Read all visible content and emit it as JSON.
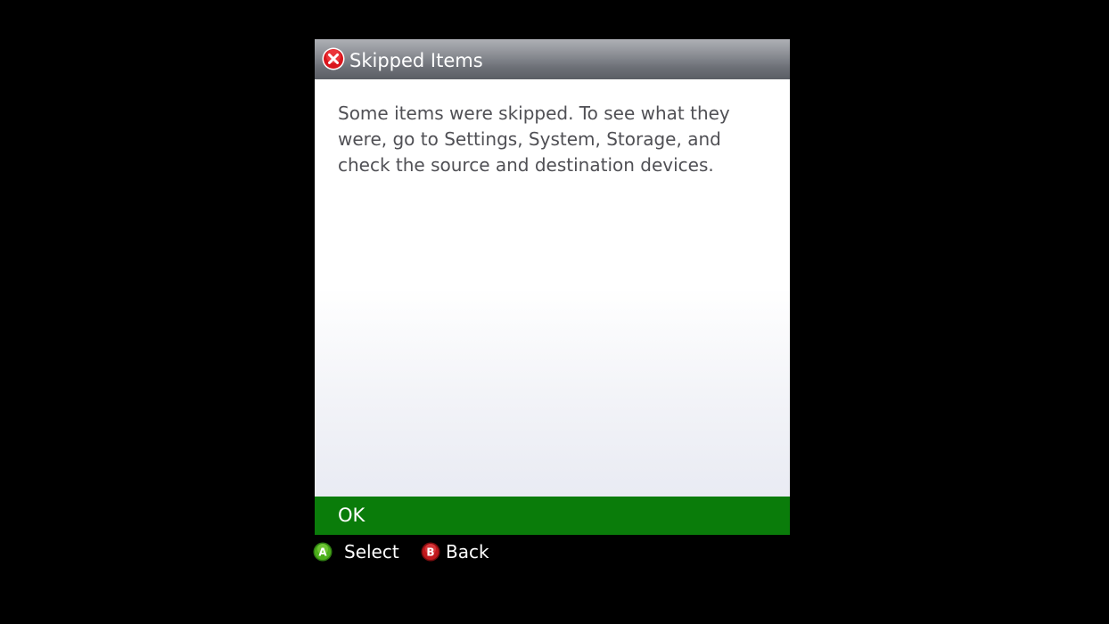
{
  "dialog": {
    "title": "Skipped Items",
    "title_icon": "error-x-icon",
    "message": "Some items were skipped. To see what they were, go to Settings, System, Storage, and check the source and destination devices.",
    "ok_label": "OK"
  },
  "controller_hints": [
    {
      "glyph": "A",
      "label": "Select",
      "color": "#4caf1a"
    },
    {
      "glyph": "B",
      "label": "Back",
      "color": "#c0181c"
    }
  ],
  "colors": {
    "background": "#000000",
    "ok_button": "#0a7c0a",
    "error_icon": "#d9151c"
  }
}
